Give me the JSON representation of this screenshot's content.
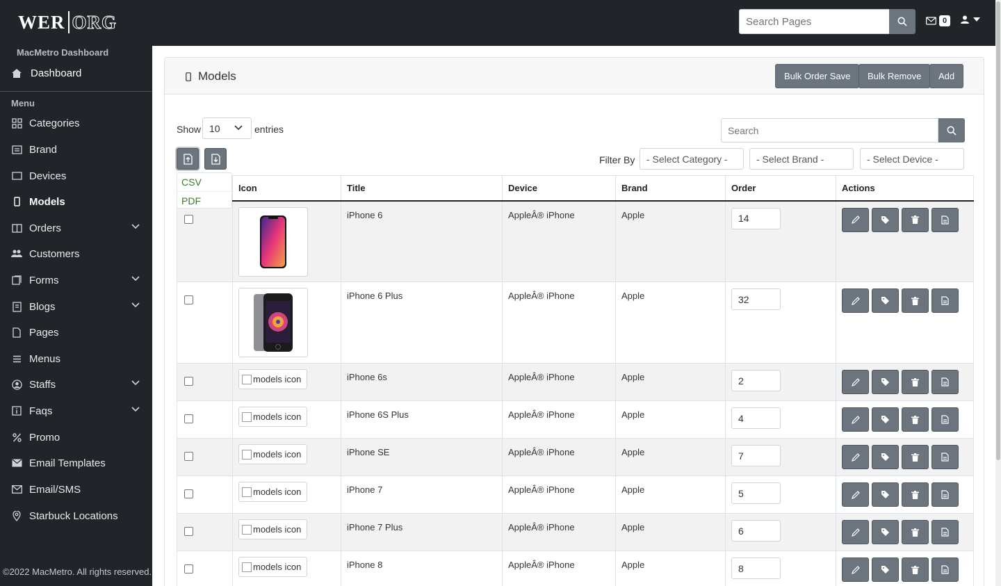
{
  "header": {
    "logo_left": "WER",
    "logo_right": "ORG",
    "search_placeholder": "Search Pages",
    "mail_count": "0"
  },
  "sidebar": {
    "brand": "MacMetro Dashboard",
    "dashboard": "Dashboard",
    "menu_label": "Menu",
    "items": [
      {
        "label": "Categories"
      },
      {
        "label": "Brand"
      },
      {
        "label": "Devices"
      },
      {
        "label": "Models"
      },
      {
        "label": "Orders"
      },
      {
        "label": "Customers"
      },
      {
        "label": "Forms"
      },
      {
        "label": "Blogs"
      },
      {
        "label": "Pages"
      },
      {
        "label": "Menus"
      },
      {
        "label": "Staffs"
      },
      {
        "label": "Faqs"
      },
      {
        "label": "Promo"
      },
      {
        "label": "Email Templates"
      },
      {
        "label": "Email/SMS"
      },
      {
        "label": "Starbuck Locations"
      }
    ],
    "footer": "©2022 MacMetro. All rights reserved."
  },
  "page": {
    "title": "Models",
    "buttons": {
      "bulk_save": "Bulk Order Save",
      "bulk_remove": "Bulk Remove",
      "add": "Add"
    },
    "show_label": "Show",
    "show_value": "10",
    "entries_label": "entries",
    "search_placeholder": "Search",
    "export_menu": {
      "csv": "CSV",
      "pdf": "PDF"
    },
    "filter_label": "Filter By",
    "filters": {
      "category": "- Select Category -",
      "brand": "- Select Brand -",
      "device": "- Select Device -"
    }
  },
  "table": {
    "columns": {
      "icon": "Icon",
      "title": "Title",
      "device": "Device",
      "brand": "Brand",
      "order": "Order",
      "actions": "Actions"
    },
    "broken_alt": "models icon",
    "rows": [
      {
        "title": "iPhone 6",
        "device": "AppleÂ® iPhone",
        "brand": "Apple",
        "order": "14"
      },
      {
        "title": "iPhone 6 Plus",
        "device": "AppleÂ® iPhone",
        "brand": "Apple",
        "order": "32"
      },
      {
        "title": "iPhone 6s",
        "device": "AppleÂ® iPhone",
        "brand": "Apple",
        "order": "2"
      },
      {
        "title": "iPhone 6S Plus",
        "device": "AppleÂ® iPhone",
        "brand": "Apple",
        "order": "4"
      },
      {
        "title": "iPhone SE",
        "device": "AppleÂ® iPhone",
        "brand": "Apple",
        "order": "7"
      },
      {
        "title": "iPhone 7",
        "device": "AppleÂ® iPhone",
        "brand": "Apple",
        "order": "5"
      },
      {
        "title": "iPhone 7 Plus",
        "device": "AppleÂ® iPhone",
        "brand": "Apple",
        "order": "6"
      },
      {
        "title": "iPhone 8",
        "device": "AppleÂ® iPhone",
        "brand": "Apple",
        "order": "8"
      }
    ]
  },
  "colors": {
    "topbar": "#212529",
    "button": "#6c757d",
    "link_green": "#3d7a29"
  }
}
